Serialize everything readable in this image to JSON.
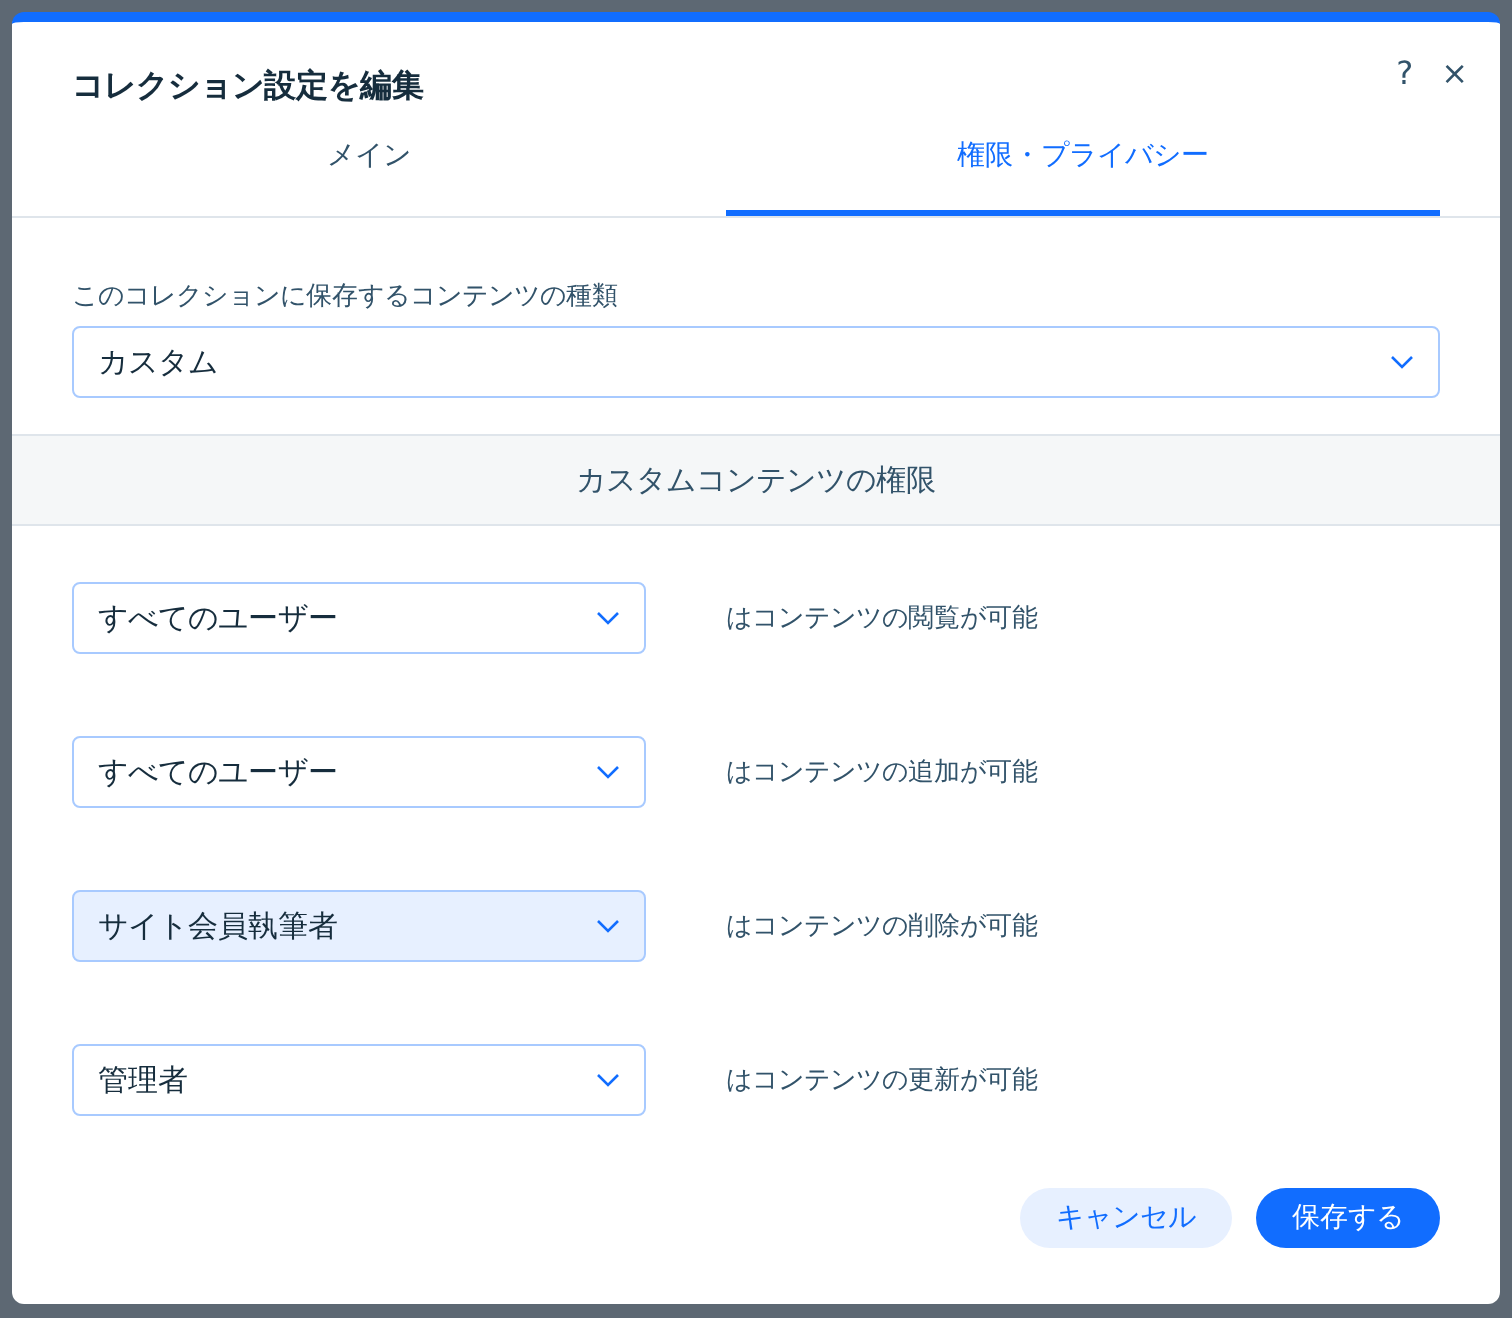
{
  "dialog": {
    "title": "コレクション設定を編集",
    "help": "?",
    "close": "×"
  },
  "tabs": [
    {
      "label": "メイン",
      "selected": false
    },
    {
      "label": "権限・プライバシー",
      "selected": true
    }
  ],
  "content_type": {
    "label": "このコレクションに保存するコンテンツの種類",
    "value": "カスタム"
  },
  "section_title": "カスタムコンテンツの権限",
  "permissions": [
    {
      "value": "すべてのユーザー",
      "text": "はコンテンツの閲覧が可能",
      "highlighted": false
    },
    {
      "value": "すべてのユーザー",
      "text": "はコンテンツの追加が可能",
      "highlighted": false
    },
    {
      "value": "サイト会員執筆者",
      "text": "はコンテンツの削除が可能",
      "highlighted": true
    },
    {
      "value": "管理者",
      "text": "はコンテンツの更新が可能",
      "highlighted": false
    }
  ],
  "buttons": [
    {
      "label": "キャンセル",
      "kind": "secondary"
    },
    {
      "label": "保存する",
      "kind": "primary"
    }
  ]
}
